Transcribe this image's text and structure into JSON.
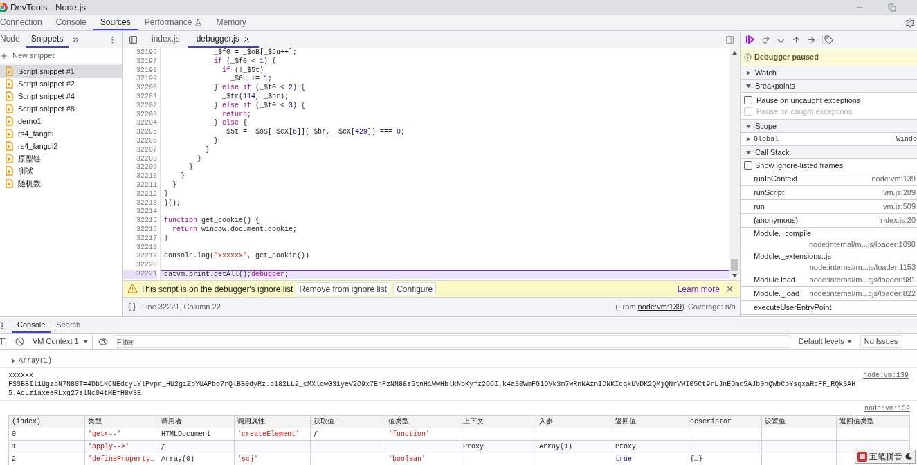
{
  "window": {
    "title": "DevTools - Node.js"
  },
  "main_tabs": [
    {
      "label": "Connection",
      "selected": false,
      "kind": "plain"
    },
    {
      "label": "Console",
      "selected": false,
      "kind": "plain"
    },
    {
      "label": "Sources",
      "selected": true,
      "kind": "plain"
    },
    {
      "label": "Performance",
      "selected": false,
      "kind": "experiment"
    },
    {
      "label": "Memory",
      "selected": false,
      "kind": "plain"
    }
  ],
  "navigator": {
    "tabs": [
      {
        "label": "Node",
        "selected": false
      },
      {
        "label": "Snippets",
        "selected": true
      }
    ],
    "new_snippet": "New snippet",
    "files": [
      {
        "name": "Script snippet #1",
        "selected": true
      },
      {
        "name": "Script snippet #2",
        "selected": false
      },
      {
        "name": "Script snippet #4",
        "selected": false
      },
      {
        "name": "Script snippet #8",
        "selected": false
      },
      {
        "name": "demo1",
        "selected": false
      },
      {
        "name": "rs4_fangdi",
        "selected": false
      },
      {
        "name": "rs4_fangdi2",
        "selected": false
      },
      {
        "name": "原型链",
        "selected": false
      },
      {
        "name": "測試",
        "selected": false
      },
      {
        "name": "随机数",
        "selected": false
      }
    ]
  },
  "editor": {
    "tabs": [
      {
        "label": "index.js",
        "selected": false,
        "closable": false
      },
      {
        "label": "debugger.js",
        "selected": true,
        "closable": true
      }
    ],
    "lines": [
      {
        "n": "32196",
        "paused": false,
        "tokens": [
          {
            "kind": "plain",
            "text": "            _$f0 = _$oB[_$6u++];"
          }
        ]
      },
      {
        "n": "32197",
        "paused": false,
        "tokens": [
          {
            "kind": "keyword",
            "text": "            if"
          },
          {
            "kind": "plain",
            "text": " (_$f0 <"
          },
          {
            "kind": "number",
            "text": " 1"
          },
          {
            "kind": "plain",
            "text": ") {"
          }
        ]
      },
      {
        "n": "32198",
        "paused": false,
        "tokens": [
          {
            "kind": "keyword",
            "text": "              if"
          },
          {
            "kind": "plain",
            "text": " (!_$5t)"
          }
        ]
      },
      {
        "n": "32199",
        "paused": false,
        "tokens": [
          {
            "kind": "plain",
            "text": "                _$6u += "
          },
          {
            "kind": "number",
            "text": "1"
          },
          {
            "kind": "plain",
            "text": ";"
          }
        ]
      },
      {
        "n": "32200",
        "paused": false,
        "tokens": [
          {
            "kind": "plain",
            "text": "            } "
          },
          {
            "kind": "keyword",
            "text": "else if"
          },
          {
            "kind": "plain",
            "text": " (_$f0 < "
          },
          {
            "kind": "number",
            "text": "2"
          },
          {
            "kind": "plain",
            "text": ") {"
          }
        ]
      },
      {
        "n": "32201",
        "paused": false,
        "tokens": [
          {
            "kind": "plain",
            "text": "              _$tr("
          },
          {
            "kind": "number",
            "text": "114"
          },
          {
            "kind": "plain",
            "text": ", _$br);"
          }
        ]
      },
      {
        "n": "32202",
        "paused": false,
        "tokens": [
          {
            "kind": "plain",
            "text": "            } "
          },
          {
            "kind": "keyword",
            "text": "else if"
          },
          {
            "kind": "plain",
            "text": " (_$f0 < "
          },
          {
            "kind": "number",
            "text": "3"
          },
          {
            "kind": "plain",
            "text": ") {"
          }
        ]
      },
      {
        "n": "32203",
        "paused": false,
        "tokens": [
          {
            "kind": "keyword",
            "text": "              return"
          },
          {
            "kind": "plain",
            "text": ";"
          }
        ]
      },
      {
        "n": "32204",
        "paused": false,
        "tokens": [
          {
            "kind": "plain",
            "text": "            } "
          },
          {
            "kind": "keyword",
            "text": "else"
          },
          {
            "kind": "plain",
            "text": " {"
          }
        ]
      },
      {
        "n": "32205",
        "paused": false,
        "tokens": [
          {
            "kind": "plain",
            "text": "              _$5t = _$oS[_$cX["
          },
          {
            "kind": "number",
            "text": "6"
          },
          {
            "kind": "plain",
            "text": "]](_$br, _$cX["
          },
          {
            "kind": "number",
            "text": "429"
          },
          {
            "kind": "plain",
            "text": "]) === "
          },
          {
            "kind": "number",
            "text": "0"
          },
          {
            "kind": "plain",
            "text": ";"
          }
        ]
      },
      {
        "n": "32206",
        "paused": false,
        "tokens": [
          {
            "kind": "plain",
            "text": "            }"
          }
        ]
      },
      {
        "n": "32207",
        "paused": false,
        "tokens": [
          {
            "kind": "plain",
            "text": "          }"
          }
        ]
      },
      {
        "n": "32208",
        "paused": false,
        "tokens": [
          {
            "kind": "plain",
            "text": "        }"
          }
        ]
      },
      {
        "n": "32209",
        "paused": false,
        "tokens": [
          {
            "kind": "plain",
            "text": "      }"
          }
        ]
      },
      {
        "n": "32210",
        "paused": false,
        "tokens": [
          {
            "kind": "plain",
            "text": "    }"
          }
        ]
      },
      {
        "n": "32211",
        "paused": false,
        "tokens": [
          {
            "kind": "plain",
            "text": "  }"
          }
        ]
      },
      {
        "n": "32212",
        "paused": false,
        "tokens": [
          {
            "kind": "plain",
            "text": "}"
          }
        ]
      },
      {
        "n": "32213",
        "paused": false,
        "tokens": [
          {
            "kind": "plain",
            "text": ")();"
          }
        ]
      },
      {
        "n": "32214",
        "paused": false
      },
      {
        "n": "32215",
        "paused": false,
        "tokens": [
          {
            "kind": "keyword",
            "text": "function"
          },
          {
            "kind": "plain",
            "text": " get_cookie() {"
          }
        ]
      },
      {
        "n": "32216",
        "paused": false,
        "tokens": [
          {
            "kind": "keyword",
            "text": "  return"
          },
          {
            "kind": "plain",
            "text": " window.document.cookie;"
          }
        ]
      },
      {
        "n": "32217",
        "paused": false,
        "tokens": [
          {
            "kind": "plain",
            "text": "}"
          }
        ]
      },
      {
        "n": "32218",
        "paused": false
      },
      {
        "n": "32219",
        "paused": false,
        "tokens": [
          {
            "kind": "plain",
            "text": "console.log("
          },
          {
            "kind": "string",
            "text": "\"xxxxxx\""
          },
          {
            "kind": "plain",
            "text": ", get_cookie())"
          }
        ]
      },
      {
        "n": "32220",
        "paused": false
      },
      {
        "n": "32221",
        "paused": true,
        "tokens": [
          {
            "kind": "plain",
            "text": "catvm.print.getAll();"
          },
          {
            "kind": "keyword",
            "text": "debugger"
          },
          {
            "kind": "plain",
            "text": ";"
          }
        ]
      }
    ],
    "ignore_bar": {
      "message": "This script is on the debugger's ignore list",
      "buttons": [
        "Remove from ignore list",
        "Configure"
      ],
      "link": "Learn more"
    },
    "status": {
      "position": "Line 32221, Column 22",
      "from_open": "(From ",
      "from_link": "node:vm:139",
      "from_close": ")",
      "coverage": "Coverage: n/a"
    }
  },
  "debugger": {
    "banner": "Debugger paused",
    "watch": {
      "title": "Watch",
      "expanded": false
    },
    "breakpoints": {
      "title": "Breakpoints",
      "expanded": true,
      "options": [
        {
          "label": "Pause on uncaught exceptions",
          "checked": false,
          "disabled": false
        },
        {
          "label": "Pause on caught exceptions",
          "checked": false,
          "disabled": true
        }
      ]
    },
    "scope": {
      "title": "Scope",
      "expanded": true,
      "items": [
        {
          "name": "Global",
          "value": "Windo",
          "expanded": false
        }
      ]
    },
    "call_stack": {
      "title": "Call Stack",
      "expanded": true,
      "option": {
        "label": "Show ignore-listed frames",
        "checked": false
      },
      "frames": [
        {
          "name": "runInContext",
          "location": "node:vm:139",
          "kind": "inline"
        },
        {
          "name": "runScript",
          "location": "vm.js:289",
          "kind": "inline"
        },
        {
          "name": "run",
          "location": "vm.js:509",
          "kind": "inline"
        },
        {
          "name": "(anonymous)",
          "location": "index.js:20",
          "kind": "inline"
        },
        {
          "name": "Module._compile",
          "location": "node:internal/m...js/loader:1098",
          "kind": "wrapped"
        },
        {
          "name": "Module._extensions..js",
          "location": "node:internal/m...js/loader:1153",
          "kind": "wrapped"
        },
        {
          "name": "Module.load",
          "location": "node:internal/m...cjs/loader:981",
          "kind": "inline"
        },
        {
          "name": "Module._load",
          "location": "node:internal/m...cjs/loader:822",
          "kind": "inline"
        },
        {
          "name": "executeUserEntryPoint",
          "kind": "inline"
        }
      ]
    }
  },
  "drawer": {
    "tabs": [
      {
        "label": "Console",
        "selected": true
      },
      {
        "label": "Search",
        "selected": false
      }
    ],
    "toolbar": {
      "context": "VM Context 1",
      "filter_placeholder": "Filter",
      "levels": "Default levels",
      "issues": "No Issues"
    },
    "messages": [
      {
        "kind": "object",
        "text": "Array(1)"
      },
      {
        "kind": "log",
        "lines": [
          "xxxxxx",
          "FSSBBIl1UgzbN7N80T=4Db1NCNEdcyLYlPvpr_HU2giZpYUAPbo7rQlBB0dyRz.p182LL2_cMXlowG31yeV2O9x7EnPzNN88s5tnH1WwHblkNbKyfz2OOI.k4aS0WmFG1OVk3m7wRnNAznIDNKIcqkUVDK2QMjQNrVWI05Ct9rLJnEDmc5AJb0hQWbCoYsqxaRcFF_RQkSAH5.AcLz1axeeRLxg27slNc04tMEfH8v3E"
        ],
        "source": "node:vm:139"
      },
      {
        "kind": "table",
        "source": "node:vm:139",
        "columns": [
          "(index)",
          "类型",
          "调用者",
          "调用属性",
          "获取值",
          "值类型",
          "上下文",
          "入参",
          "返回值",
          "descriptor",
          "设置值",
          "返回值类型"
        ],
        "rows": [
          [
            {
              "text": "0",
              "kind": "plain"
            },
            {
              "text": "'get<--'",
              "kind": "string"
            },
            {
              "text": "HTMLDocument",
              "kind": "plain"
            },
            {
              "text": "'createElement'",
              "kind": "string"
            },
            {
              "text": "ƒ",
              "kind": "italic"
            },
            {
              "text": "'function'",
              "kind": "string"
            },
            {
              "text": "",
              "kind": "plain"
            },
            {
              "text": "",
              "kind": "plain"
            },
            {
              "text": "",
              "kind": "plain"
            },
            {
              "text": "",
              "kind": "plain"
            },
            {
              "text": "",
              "kind": "plain"
            },
            {
              "text": "",
              "kind": "plain"
            }
          ],
          [
            {
              "text": "1",
              "kind": "plain"
            },
            {
              "text": "'apply-->'",
              "kind": "string"
            },
            {
              "text": "ƒ",
              "kind": "italic"
            },
            {
              "text": "",
              "kind": "plain"
            },
            {
              "text": "",
              "kind": "plain"
            },
            {
              "text": "",
              "kind": "plain"
            },
            {
              "text": "Proxy",
              "kind": "plain"
            },
            {
              "text": "Array(1)",
              "kind": "plain"
            },
            {
              "text": "Proxy",
              "kind": "plain"
            },
            {
              "text": "",
              "kind": "plain"
            },
            {
              "text": "",
              "kind": "plain"
            },
            {
              "text": "",
              "kind": "plain"
            }
          ],
          [
            {
              "text": "2",
              "kind": "plain"
            },
            {
              "text": "'defineProperty…",
              "kind": "string"
            },
            {
              "text": "Array(0)",
              "kind": "plain"
            },
            {
              "text": "'scj'",
              "kind": "string"
            },
            {
              "text": "",
              "kind": "plain"
            },
            {
              "text": "'boolean'",
              "kind": "string"
            },
            {
              "text": "",
              "kind": "plain"
            },
            {
              "text": "",
              "kind": "plain"
            },
            {
              "text": "true",
              "kind": "boolean"
            },
            {
              "text": "{…}",
              "kind": "plain"
            },
            {
              "text": "",
              "kind": "plain"
            },
            {
              "text": "",
              "kind": "plain"
            }
          ]
        ]
      }
    ]
  },
  "ime_toolbar": {
    "label": "五笔拼音"
  }
}
